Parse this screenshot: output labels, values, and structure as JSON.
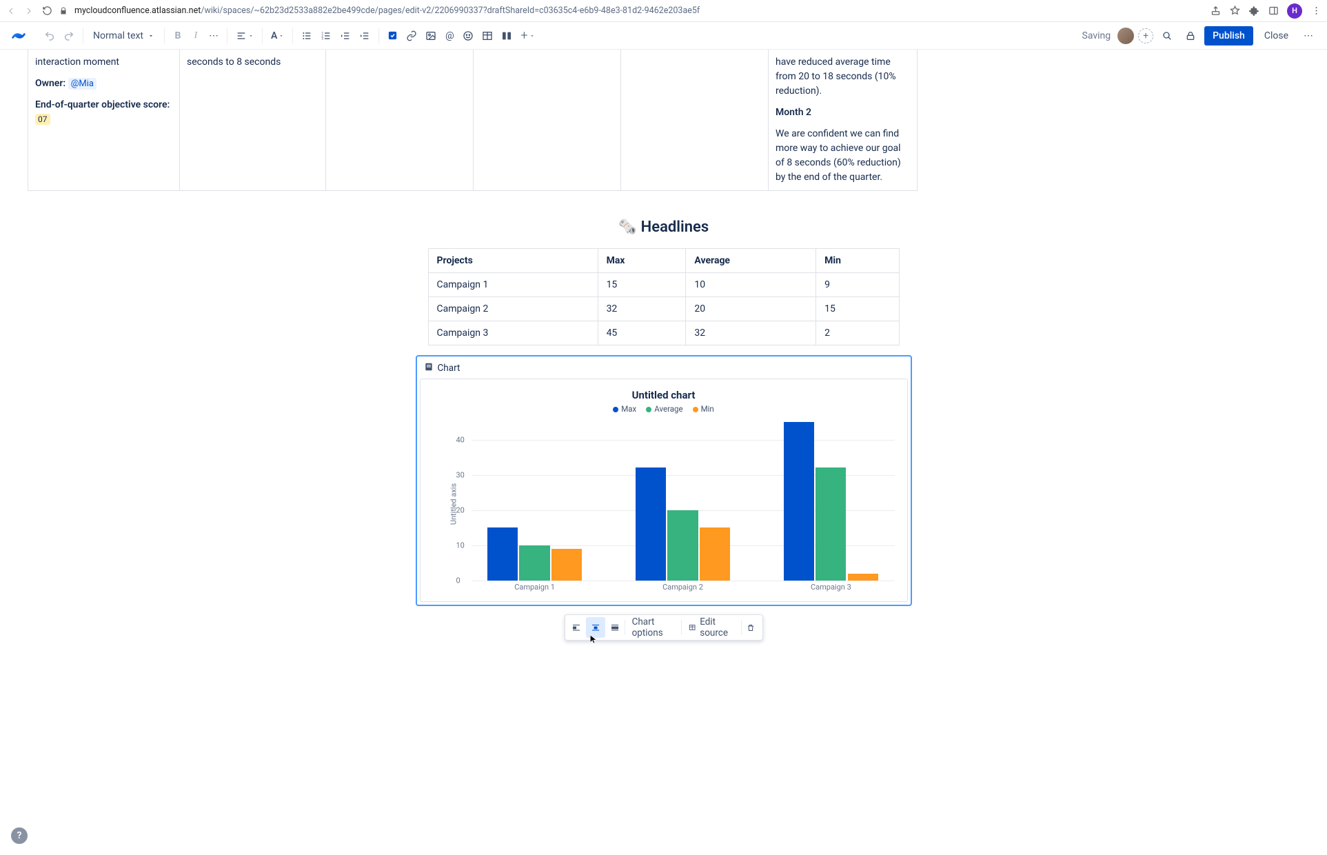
{
  "chrome": {
    "url_prefix": "mycloudconfluence.atlassian.net",
    "url_rest": "/wiki/spaces/~62b23d2533a882e2be499cde/pages/edit-v2/2206990337?draftShareId=c03635c4-e6b9-48e3-81d2-9462e203ae5f",
    "avatar_letter": "H"
  },
  "toolbar": {
    "text_style": "Normal text",
    "saving": "Saving",
    "publish": "Publish",
    "close": "Close"
  },
  "cells": {
    "c0_line1": "interaction moment",
    "c0_owner_lbl": "Owner:",
    "c0_owner_val": "@Mia",
    "c0_eoq_lbl": "End-of-quarter objective score:",
    "c0_eoq_val": "07",
    "c1_text": "seconds to 8 seconds",
    "c5_p1": "have reduced average time from 20 to 18 seconds (10% reduction).",
    "c5_h": "Month 2",
    "c5_p2": "We are confident we can find more way to achieve our goal of 8 seconds (60% reduction) by the end of the quarter."
  },
  "headlines_title": "🗞️ Headlines",
  "table": {
    "headers": [
      "Projects",
      "Max",
      "Average",
      "Min"
    ],
    "rows": [
      [
        "Campaign 1",
        "15",
        "10",
        "9"
      ],
      [
        "Campaign 2",
        "32",
        "20",
        "15"
      ],
      [
        "Campaign 3",
        "45",
        "32",
        "2"
      ]
    ]
  },
  "chart_block": {
    "label": "Chart",
    "toolbar_options": "Chart options",
    "toolbar_edit": "Edit source"
  },
  "chart_data": {
    "type": "bar",
    "title": "Untitled chart",
    "ylabel": "Untitled axis",
    "xlabel": "",
    "ylim": [
      0,
      45
    ],
    "yticks": [
      0,
      10,
      20,
      30,
      40
    ],
    "categories": [
      "Campaign 1",
      "Campaign 2",
      "Campaign 3"
    ],
    "series": [
      {
        "name": "Max",
        "color": "#0052cc",
        "values": [
          15,
          32,
          45
        ]
      },
      {
        "name": "Average",
        "color": "#36b37e",
        "values": [
          10,
          20,
          32
        ]
      },
      {
        "name": "Min",
        "color": "#ff991f",
        "values": [
          9,
          15,
          2
        ]
      }
    ]
  }
}
